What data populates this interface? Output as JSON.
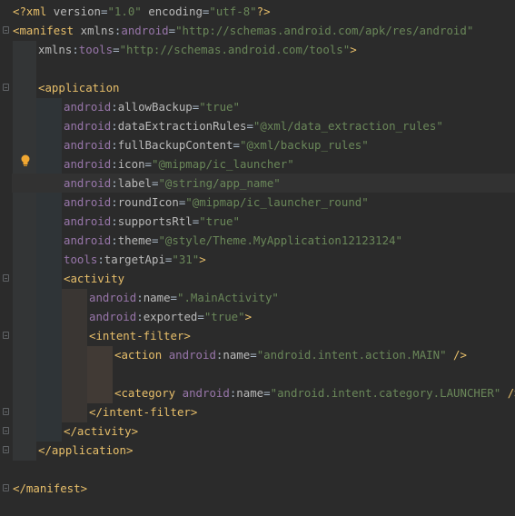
{
  "editor": {
    "language": "xml",
    "lines": [
      {
        "indent": 0,
        "tokens": [
          [
            "tag",
            "<?xml "
          ],
          [
            "attr",
            "version"
          ],
          [
            "plain",
            "="
          ],
          [
            "val",
            "\"1.0\""
          ],
          [
            "plain",
            " "
          ],
          [
            "attr",
            "encoding"
          ],
          [
            "plain",
            "="
          ],
          [
            "val",
            "\"utf-8\""
          ],
          [
            "tag",
            "?>"
          ]
        ]
      },
      {
        "indent": 0,
        "tokens": [
          [
            "tag",
            "<manifest "
          ],
          [
            "attr",
            "xmlns"
          ],
          [
            "plain",
            ":"
          ],
          [
            "ns",
            "android"
          ],
          [
            "plain",
            "="
          ],
          [
            "val",
            "\"http://schemas.android.com/apk/res/android\""
          ]
        ]
      },
      {
        "indent": 1,
        "tokens": [
          [
            "attr",
            "xmlns"
          ],
          [
            "plain",
            ":"
          ],
          [
            "ns",
            "tools"
          ],
          [
            "plain",
            "="
          ],
          [
            "val",
            "\"http://schemas.android.com/tools\""
          ],
          [
            "tag",
            ">"
          ]
        ]
      },
      {
        "indent": 0,
        "tokens": []
      },
      {
        "indent": 1,
        "tokens": [
          [
            "tag",
            "<application"
          ]
        ]
      },
      {
        "indent": 2,
        "tokens": [
          [
            "ns",
            "android"
          ],
          [
            "plain",
            ":"
          ],
          [
            "attr",
            "allowBackup"
          ],
          [
            "plain",
            "="
          ],
          [
            "val",
            "\"true\""
          ]
        ]
      },
      {
        "indent": 2,
        "tokens": [
          [
            "ns",
            "android"
          ],
          [
            "plain",
            ":"
          ],
          [
            "attr",
            "dataExtractionRules"
          ],
          [
            "plain",
            "="
          ],
          [
            "val",
            "\"@xml/data_extraction_rules\""
          ]
        ]
      },
      {
        "indent": 2,
        "tokens": [
          [
            "ns",
            "android"
          ],
          [
            "plain",
            ":"
          ],
          [
            "attr",
            "fullBackupContent"
          ],
          [
            "plain",
            "="
          ],
          [
            "val",
            "\"@xml/backup_rules\""
          ]
        ]
      },
      {
        "indent": 2,
        "tokens": [
          [
            "ns",
            "android"
          ],
          [
            "plain",
            ":"
          ],
          [
            "attr",
            "icon"
          ],
          [
            "plain",
            "="
          ],
          [
            "val",
            "\"@mipmap/ic_launcher\""
          ]
        ]
      },
      {
        "indent": 2,
        "tokens": [
          [
            "ns",
            "android"
          ],
          [
            "plain",
            ":"
          ],
          [
            "attr",
            "label"
          ],
          [
            "plain",
            "="
          ],
          [
            "val",
            "\"@string/app_name\""
          ]
        ]
      },
      {
        "indent": 2,
        "tokens": [
          [
            "ns",
            "android"
          ],
          [
            "plain",
            ":"
          ],
          [
            "attr",
            "roundIcon"
          ],
          [
            "plain",
            "="
          ],
          [
            "val",
            "\"@mipmap/ic_launcher_round\""
          ]
        ]
      },
      {
        "indent": 2,
        "tokens": [
          [
            "ns",
            "android"
          ],
          [
            "plain",
            ":"
          ],
          [
            "attr",
            "supportsRtl"
          ],
          [
            "plain",
            "="
          ],
          [
            "val",
            "\"true\""
          ]
        ]
      },
      {
        "indent": 2,
        "tokens": [
          [
            "ns",
            "android"
          ],
          [
            "plain",
            ":"
          ],
          [
            "attr",
            "theme"
          ],
          [
            "plain",
            "="
          ],
          [
            "val",
            "\"@style/Theme.MyApplication12123124\""
          ]
        ]
      },
      {
        "indent": 2,
        "tokens": [
          [
            "ns",
            "tools"
          ],
          [
            "plain",
            ":"
          ],
          [
            "attr",
            "targetApi"
          ],
          [
            "plain",
            "="
          ],
          [
            "val",
            "\"31\""
          ],
          [
            "tag",
            ">"
          ]
        ]
      },
      {
        "indent": 2,
        "tokens": [
          [
            "tag",
            "<activity"
          ]
        ]
      },
      {
        "indent": 3,
        "tokens": [
          [
            "ns",
            "android"
          ],
          [
            "plain",
            ":"
          ],
          [
            "attr",
            "name"
          ],
          [
            "plain",
            "="
          ],
          [
            "val",
            "\".MainActivity\""
          ]
        ]
      },
      {
        "indent": 3,
        "tokens": [
          [
            "ns",
            "android"
          ],
          [
            "plain",
            ":"
          ],
          [
            "attr",
            "exported"
          ],
          [
            "plain",
            "="
          ],
          [
            "val",
            "\"true\""
          ],
          [
            "tag",
            ">"
          ]
        ]
      },
      {
        "indent": 3,
        "tokens": [
          [
            "tag",
            "<intent-filter>"
          ]
        ]
      },
      {
        "indent": 4,
        "tokens": [
          [
            "tag",
            "<action "
          ],
          [
            "ns",
            "android"
          ],
          [
            "plain",
            ":"
          ],
          [
            "attr",
            "name"
          ],
          [
            "plain",
            "="
          ],
          [
            "val",
            "\"android.intent.action.MAIN\""
          ],
          [
            "plain",
            " "
          ],
          [
            "tag",
            "/>"
          ]
        ]
      },
      {
        "indent": 0,
        "tokens": []
      },
      {
        "indent": 4,
        "tokens": [
          [
            "tag",
            "<category "
          ],
          [
            "ns",
            "android"
          ],
          [
            "plain",
            ":"
          ],
          [
            "attr",
            "name"
          ],
          [
            "plain",
            "="
          ],
          [
            "val",
            "\"android.intent.category.LAUNCHER\""
          ],
          [
            "plain",
            " "
          ],
          [
            "tag",
            "/>"
          ]
        ]
      },
      {
        "indent": 3,
        "tokens": [
          [
            "tag",
            "</intent-filter>"
          ]
        ]
      },
      {
        "indent": 2,
        "tokens": [
          [
            "tag",
            "</activity>"
          ]
        ]
      },
      {
        "indent": 1,
        "tokens": [
          [
            "tag",
            "</application>"
          ]
        ]
      },
      {
        "indent": 0,
        "tokens": []
      },
      {
        "indent": 0,
        "tokens": [
          [
            "tag",
            "</manifest>"
          ]
        ]
      }
    ]
  },
  "gutter": {
    "fold_icons": [
      "manifest-fold",
      "application-fold",
      "activity-fold",
      "intent-filter-fold",
      "intent-filter-end-fold",
      "activity-end-fold",
      "application-end-fold",
      "manifest-end-fold"
    ],
    "intention_icon": "lightbulb-icon"
  },
  "colors": {
    "background": "#2b2b2b",
    "tag": "#e8bf6a",
    "namespace": "#9876aa",
    "attribute": "#bababa",
    "value": "#6a8759",
    "text": "#a9b7c6"
  }
}
